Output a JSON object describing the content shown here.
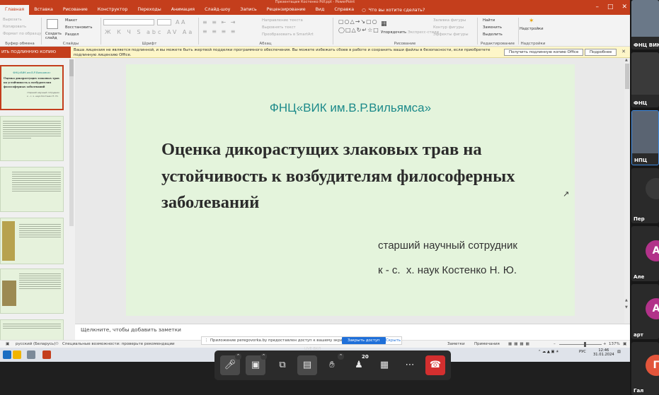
{
  "window": {
    "title": "Презентация Костенко Pdf.ppt - PowerPoint"
  },
  "ribbon_tabs": [
    "Главная",
    "Вставка",
    "Рисование",
    "Конструктор",
    "Переходы",
    "Анимация",
    "Слайд-шоу",
    "Запись",
    "Рецензирование",
    "Вид",
    "Справка"
  ],
  "tell_me": "Что вы хотите сделать?",
  "ribbon": {
    "clipboard": {
      "label": "Буфер обмена",
      "cut": "Вырезать",
      "copy": "Копировать",
      "format_painter": "Формат по образцу"
    },
    "slides": {
      "label": "Слайды",
      "new_slide": "Создать слайд",
      "layout": "Макет",
      "reset": "Восстановить",
      "section": "Раздел"
    },
    "font": {
      "label": "Шрифт"
    },
    "paragraph": {
      "label": "Абзац",
      "text_direction": "Направление текста",
      "align_text": "Выровнять текст",
      "smartart": "Преобразовать в SmartArt"
    },
    "drawing": {
      "label": "Рисование",
      "arrange": "Упорядочить",
      "quick_styles": "Экспресс-стили",
      "fill": "Заливка фигуры",
      "outline": "Контур фигуры",
      "effects": "Эффекты фигуры"
    },
    "editing": {
      "label": "Редактирование",
      "find": "Найти",
      "replace": "Заменить",
      "select": "Выделить"
    },
    "addins": {
      "label": "Надстройки",
      "button": "Надстройки"
    }
  },
  "license_bar": {
    "left_label": "ИТЬ ПОДЛИННУЮ КОПИЮ OFFICE",
    "message": "Ваша лицензия не является подлинной, и вы можете быть жертвой подделки программного обеспечения. Вы можете избежать сбоев в работе и сохранить ваши файлы в безопасности, если приобретете подлинную лицензию Office.",
    "get_button": "Получить подлинную копию Office",
    "more_button": "Подробнее"
  },
  "slide": {
    "org": "ФНЦ«ВИК им.В.Р.Вильямса»",
    "title": "Оценка дикорастущих злаковых трав на устойчивость к возбудителям философерных заболеваний",
    "author_position": "старший научный сотрудник",
    "author_name": "к - с.  х. наук Костенко Н. Ю."
  },
  "thumbnail": {
    "org": "ФНЦ«ВИК им.В.Р.Вильямса»",
    "title": "Оценка дикорастущих злаковых трав на устойчивость к возбудителям философерных заболеваний",
    "line1": "старший научный сотрудник",
    "line2": "к - с.  х. наук Костенко Н. Ю."
  },
  "notes_placeholder": "Щелкните, чтобы добавить заметки",
  "share_banner": {
    "text": "Приложение peregovorka.by предоставлен доступ к вашему экрану.",
    "stop": "Закрыть доступ",
    "hide": "Скрыть"
  },
  "status_bar": {
    "language": "русский (Беларусь)",
    "accessibility": "Специальные возможности: проверьте рекомендации",
    "notes": "Заметки",
    "comments": "Примечания",
    "zoom": "137%"
  },
  "taskbar": {
    "lang": "РУС",
    "time": "12:46",
    "date": "31.01.2024"
  },
  "participants": [
    {
      "name": "ФНЦ ВИК",
      "color": "#5c6b7a"
    },
    {
      "name": "ФНЦ",
      "color": "#3a3a3a"
    },
    {
      "name": "НПЦ",
      "color": "#556070"
    },
    {
      "name": "Пер",
      "color": "#2a2a2a"
    },
    {
      "name": "Але",
      "initial": "А",
      "color": "#b2328a"
    },
    {
      "name": "арт",
      "initial": "А",
      "color": "#b2328a"
    },
    {
      "name": "Гал",
      "initial": "Г",
      "color": "#e2553b"
    }
  ],
  "controls": {
    "hands_count": "20",
    "tooltip": "LIVE ВКЛ"
  }
}
